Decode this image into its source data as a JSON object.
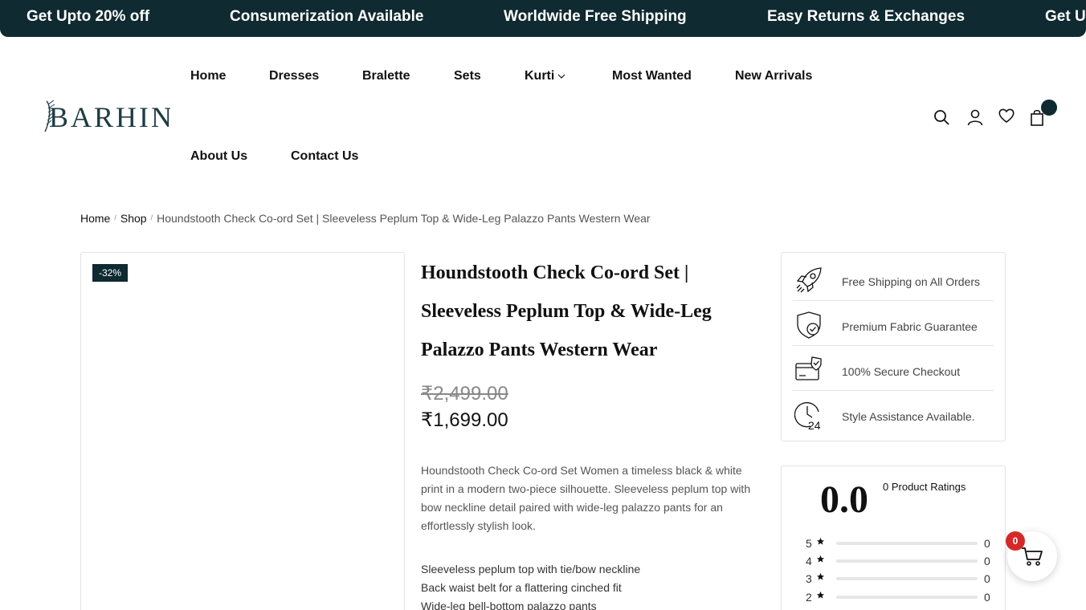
{
  "announcement": {
    "items": [
      "Get Upto 20% off",
      "Consumerization Available",
      "Worldwide Free Shipping",
      "Easy Returns & Exchanges",
      "Get U"
    ]
  },
  "brand": {
    "logo_text": "BARHIN"
  },
  "nav": {
    "items": [
      "Home",
      "Dresses",
      "Bralette",
      "Sets",
      "Kurti",
      "Most Wanted",
      "New Arrivals",
      "About Us",
      "Contact Us"
    ]
  },
  "header_icons": [
    "search-icon",
    "user-icon",
    "heart-icon",
    "shopping-bag-icon"
  ],
  "breadcrumb": {
    "home": "Home",
    "shop": "Shop",
    "current": "Houndstooth Check Co-ord Set | Sleeveless Peplum Top & Wide-Leg Palazzo Pants Western Wear"
  },
  "product": {
    "discount_badge": "-32%",
    "title": "Houndstooth Check Co-ord Set | Sleeveless Peplum Top & Wide-Leg Palazzo Pants Western Wear",
    "price_old": "₹2,499.00",
    "price_new": "₹1,699.00",
    "description": "Houndstooth Check Co-ord Set Women a timeless black & white print in a modern two-piece silhouette. Sleeveless peplum top with bow neckline detail paired with wide-leg palazzo pants for an effortlessly stylish look.",
    "bullets": [
      "Sleeveless peplum top with tie/bow neckline",
      "Back waist belt for a flattering cinched fit",
      "Wide-leg bell-bottom palazzo pants"
    ]
  },
  "features": [
    {
      "icon": "rocket-icon",
      "label": "Free Shipping on All Orders"
    },
    {
      "icon": "shield-check-icon",
      "label": "Premium Fabric Guarantee"
    },
    {
      "icon": "card-check-icon",
      "label": "100% Secure Checkout"
    },
    {
      "icon": "clock-24-icon",
      "label": "Style Assistance Available."
    }
  ],
  "ratings": {
    "average": "0.0",
    "count_label": "0 Product Ratings",
    "rows": [
      {
        "stars": "5",
        "count": "0",
        "fill": 0
      },
      {
        "stars": "4",
        "count": "0",
        "fill": 0
      },
      {
        "stars": "3",
        "count": "0",
        "fill": 0
      },
      {
        "stars": "2",
        "count": "0",
        "fill": 0
      }
    ]
  },
  "floating_cart": {
    "count": "0"
  },
  "colors": {
    "brand_dark": "#0f2a30",
    "cart_badge": "#d62828"
  }
}
